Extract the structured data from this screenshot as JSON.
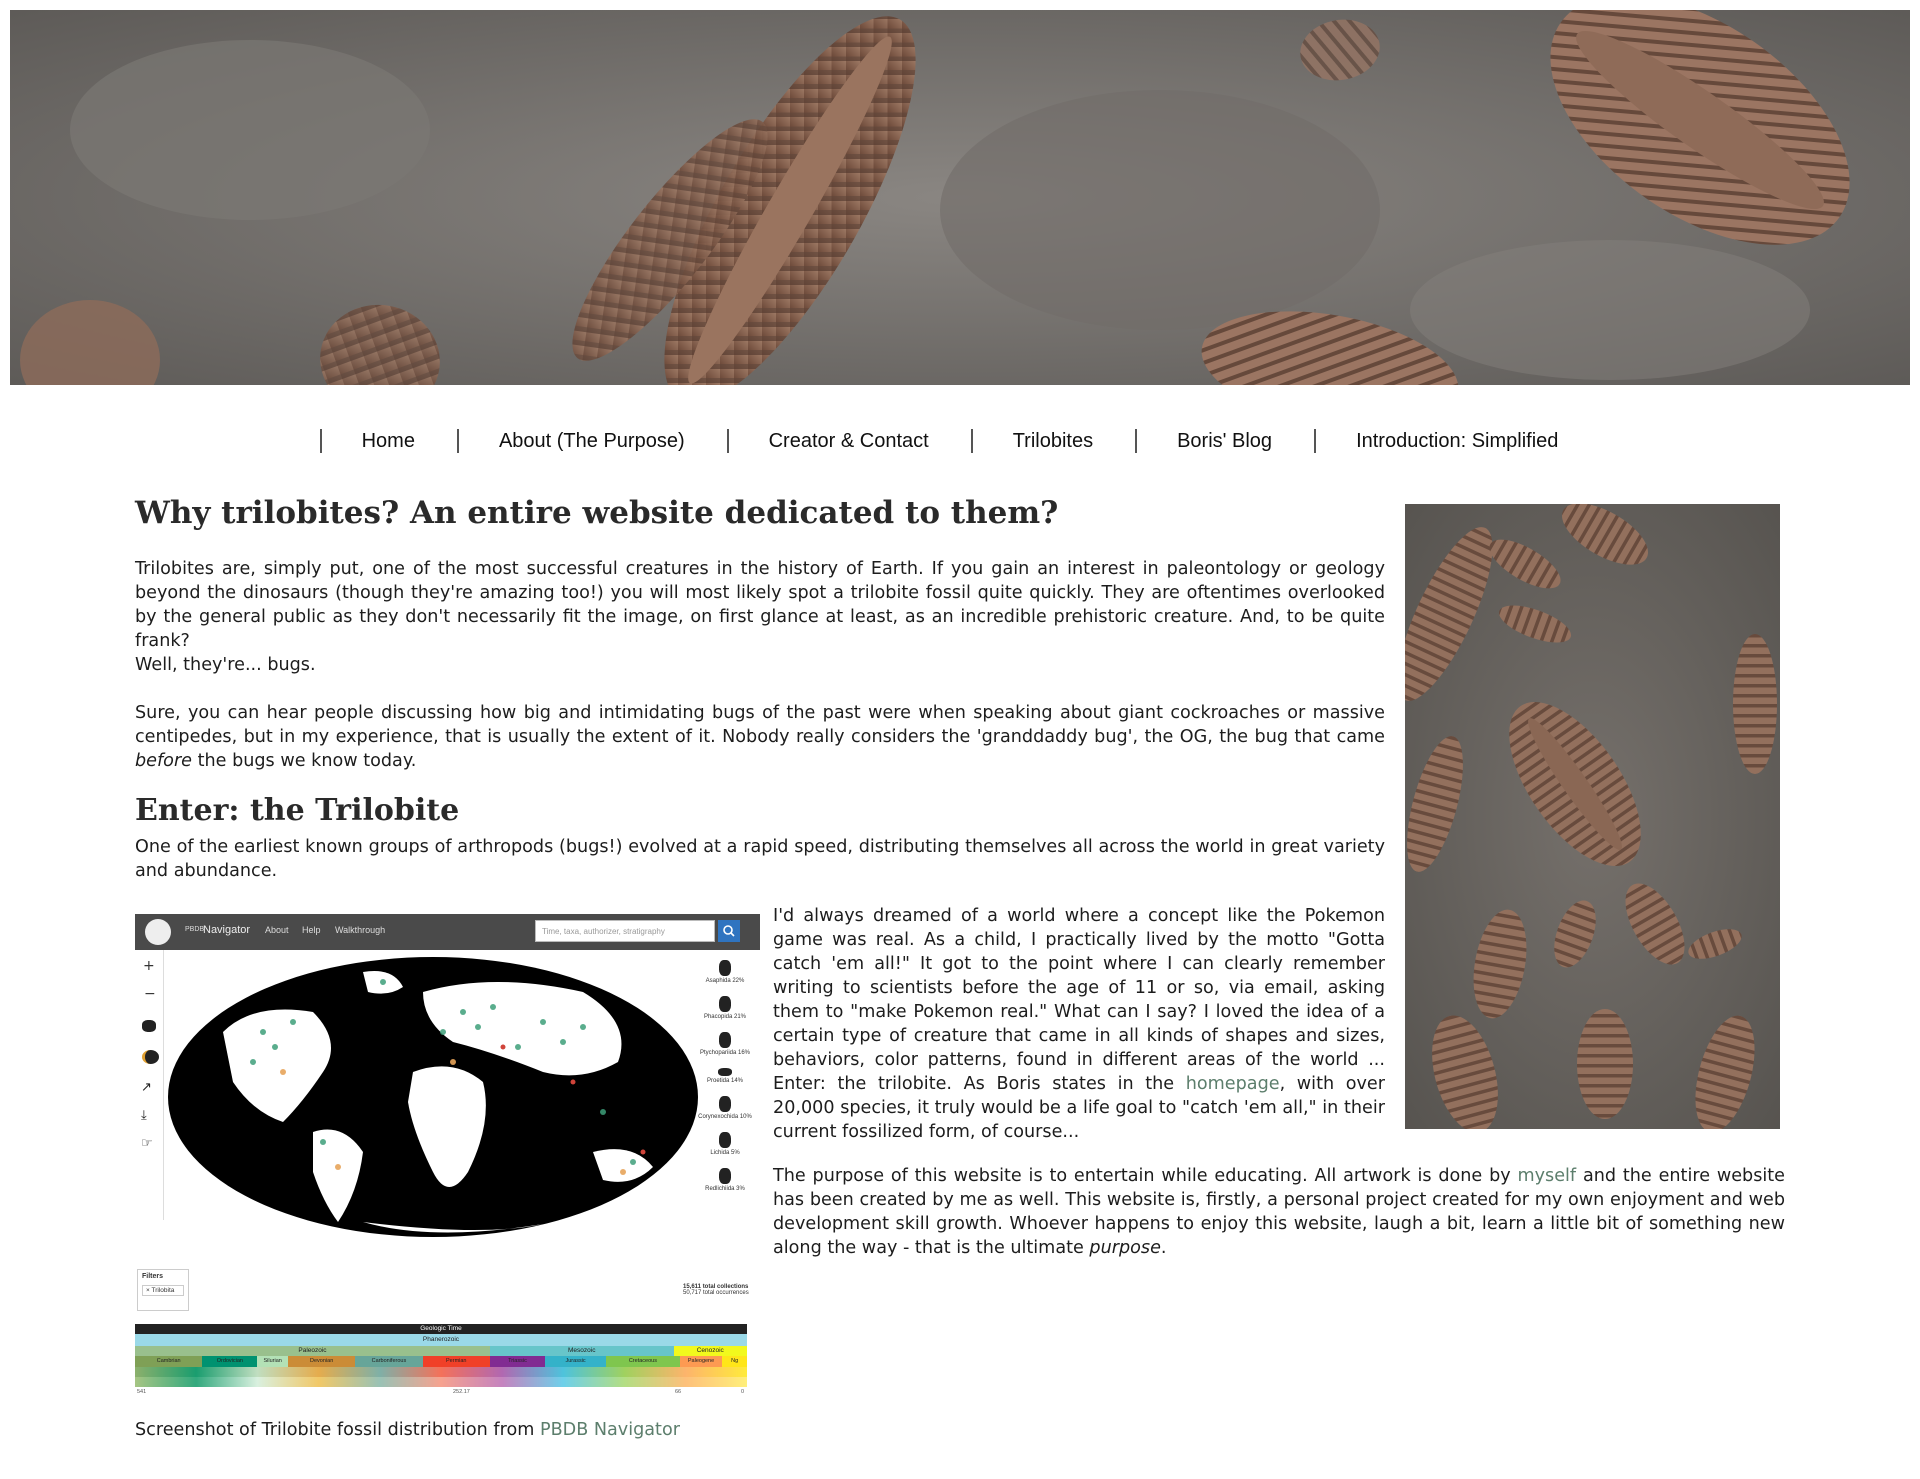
{
  "banner": {
    "image": "trilobite-fossil-slab-banner"
  },
  "nav": {
    "items": [
      {
        "label": "Home"
      },
      {
        "label": "About (The Purpose)"
      },
      {
        "label": "Creator & Contact"
      },
      {
        "label": "Trilobites"
      },
      {
        "label": "Boris' Blog"
      },
      {
        "label": "Introduction: Simplified"
      }
    ]
  },
  "main": {
    "heading": "Why trilobites? An entire website dedicated to them?",
    "p1": "Trilobites are, simply put, one of the most successful creatures in the history of Earth. If you gain an interest in paleontology or geology beyond the dinosaurs (though they're amazing too!) you will most likely spot a trilobite fossil quite quickly. They are oftentimes overlooked by the general public as they don't necessarily fit the image, on first glance at least, as an incredible prehistoric creature. And, to be quite frank?",
    "p2": "Well, they're... bugs.",
    "p3_a": "Sure, you can hear people discussing how big and intimidating bugs of the past were when speaking about giant cockroaches or massive centipedes, but in my experience, that is usually the extent of it. Nobody really considers the 'granddaddy bug', the OG, the bug that came ",
    "p3_em": "before",
    "p3_b": " the bugs we know today.",
    "subheading": "Enter: the Trilobite",
    "p4": "One of the earliest known groups of arthropods (bugs!) evolved at a rapid speed, distributing themselves all across the world in great variety and abundance.",
    "p5_a": "I'd always dreamed of a world where a concept like the Pokemon game was real. As a child, I practically lived by the motto \"Gotta catch 'em all!\" It got to the point where I can clearly remember writing to scientists before the age of 11 or so, via email, asking them to \"make Pokemon real.\" What can I say? I loved the idea of a certain type of creature that came in all kinds of shapes and sizes, behaviors, color patterns, found in different areas of the world ... Enter: the trilobite. As Boris states in the ",
    "p5_link": "homepage",
    "p5_b": ", with over 20,000 species, it truly would be a life goal to \"catch 'em all,\" in their current fossilized form, of course...",
    "p6_a": "The purpose of this website is to entertain while educating. All artwork is done by ",
    "p6_link": "myself",
    "p6_b": " and the entire website has been created by me as well. This website is, firstly, a personal project created for my own enjoyment and web development skill growth. Whoever happens to enjoy this website, laugh a bit, learn a little bit of something new along the way - that is the ultimate ",
    "p6_em": "purpose",
    "p6_c": ".",
    "caption_a": "Screenshot of Trilobite fossil distribution from ",
    "caption_link": "PBDB Navigator"
  },
  "navigator": {
    "brand_small": "PBDB",
    "brand": "Navigator",
    "menu": [
      "About",
      "Help",
      "Walkthrough"
    ],
    "search_placeholder": "Time, taxa, authorizer, stratigraphy",
    "taxa": [
      "Asaphida 22%",
      "Phacopida 21%",
      "Ptychopariida 16%",
      "Proetida 14%",
      "Corynexochida 10%",
      "Lichida 5%",
      "Redlichiida 3%"
    ],
    "filters_title": "Filters",
    "filter_tag": "Trilobita",
    "stats_line1": "15,611 total collections",
    "stats_line2": "50,717 total occurrences",
    "timescale_title": "Geologic Time",
    "eon": "Phanerozoic",
    "eras": [
      "Paleozoic",
      "Mesozoic",
      "Cenozoic"
    ],
    "periods": [
      "Cambrian",
      "Ordovician",
      "Silurian",
      "Devonian",
      "Carboniferous",
      "Permian",
      "Triassic",
      "Jurassic",
      "Cretaceous",
      "Paleogene",
      "Ng"
    ],
    "ticks": [
      "541",
      "252.17",
      "66",
      "0"
    ]
  }
}
